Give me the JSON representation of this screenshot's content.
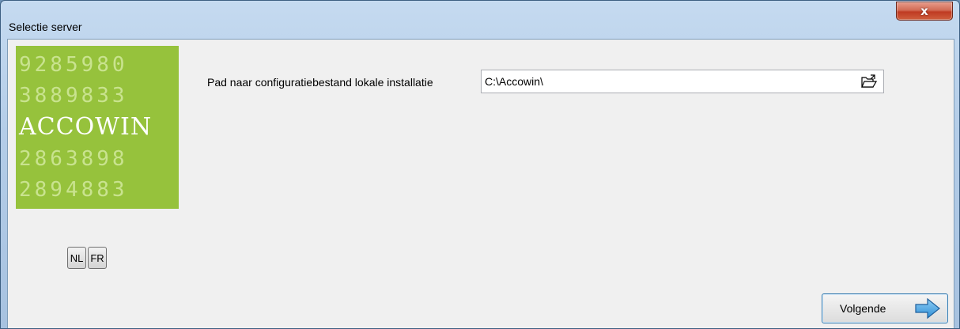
{
  "window": {
    "title": "Selectie server",
    "close_label": "x"
  },
  "logo": {
    "rows": [
      "9285980",
      "3889833",
      "ACCOWIN",
      "2863898",
      "2894883"
    ]
  },
  "language": {
    "nl_label": "NL",
    "fr_label": "FR"
  },
  "config": {
    "label": "Pad naar configuratiebestand lokale installatie",
    "value": "C:\\Accowin\\"
  },
  "footer": {
    "next_label": "Volgende"
  },
  "colors": {
    "logo_bg": "#96c23c",
    "logo_digits": "#c9e38f",
    "close_red": "#c9462a"
  },
  "icons": {
    "browse": "open-folder-icon",
    "next": "arrow-right-icon"
  }
}
